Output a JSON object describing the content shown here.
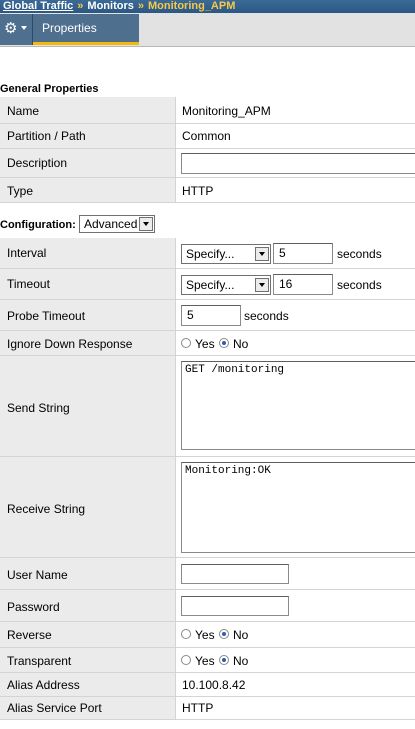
{
  "breadcrumb": {
    "items": [
      "Global Traffic",
      "Monitors",
      "Monitoring_APM"
    ],
    "separator": "»"
  },
  "toolbar": {
    "gear_icon": "gear-icon",
    "tab_label": "Properties"
  },
  "general": {
    "title": "General Properties",
    "name_label": "Name",
    "name_value": "Monitoring_APM",
    "partition_label": "Partition / Path",
    "partition_value": "Common",
    "description_label": "Description",
    "description_value": "",
    "type_label": "Type",
    "type_value": "HTTP"
  },
  "configuration": {
    "label": "Configuration:",
    "mode": "Advanced",
    "interval_label": "Interval",
    "interval_mode": "Specify...",
    "interval_value": "5",
    "interval_unit": "seconds",
    "timeout_label": "Timeout",
    "timeout_mode": "Specify...",
    "timeout_value": "16",
    "timeout_unit": "seconds",
    "probe_label": "Probe Timeout",
    "probe_value": "5",
    "probe_unit": "seconds",
    "ignore_label": "Ignore Down Response",
    "send_label": "Send String",
    "send_value": "GET /monitoring",
    "receive_label": "Receive String",
    "receive_value": "Monitoring:OK",
    "user_label": "User Name",
    "user_value": "",
    "password_label": "Password",
    "password_value": "",
    "reverse_label": "Reverse",
    "transparent_label": "Transparent",
    "alias_addr_label": "Alias Address",
    "alias_addr_value": "10.100.8.42",
    "alias_port_label": "Alias Service Port",
    "alias_port_value": "HTTP"
  },
  "radio": {
    "yes": "Yes",
    "no": "No",
    "ignore_selected": "No",
    "reverse_selected": "No",
    "transparent_selected": "No"
  },
  "colors": {
    "header_blue": "#2a5784",
    "breadcrumb_current": "#f7c948",
    "tab_accent": "#f2b80a",
    "label_bg": "#ebebeb"
  }
}
